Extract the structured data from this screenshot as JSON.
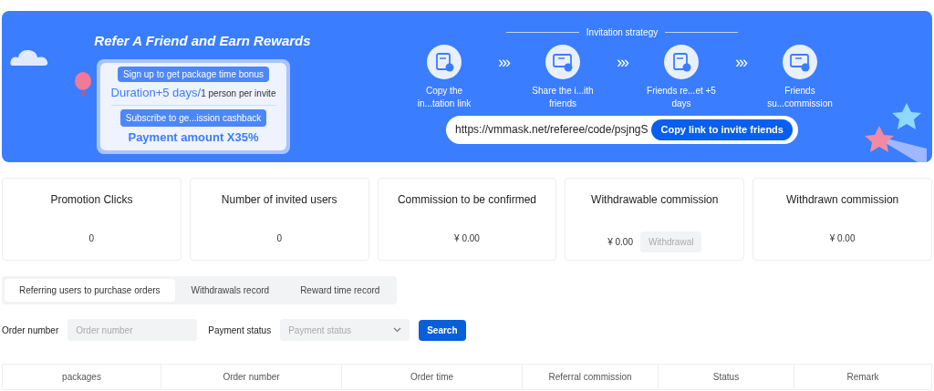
{
  "banner": {
    "title": "Refer A Friend and Earn Rewards",
    "signup_badge": "Sign up to get package time bonus",
    "duration": "Duration+5 days/",
    "per_invite": "1 person per invite",
    "subscribe_badge": "Subscribe to ge...ission cashback",
    "payment": "Payment amount X35%",
    "strategy_title": "Invitation strategy",
    "steps": [
      {
        "label": "Copy the in...tation link"
      },
      {
        "label": "Share the i...ith friends"
      },
      {
        "label": "Friends re...et +5 days"
      },
      {
        "label": "Friends su...commission"
      }
    ],
    "step_arrow": "›››",
    "link": "https://vmmask.net/referee/code/psjngS",
    "copy_button": "Copy link to invite friends"
  },
  "stats": [
    {
      "title": "Promotion Clicks",
      "value": "0"
    },
    {
      "title": "Number of invited users",
      "value": "0"
    },
    {
      "title": "Commission to be confirmed",
      "value": "¥ 0.00"
    },
    {
      "title": "Withdrawable commission",
      "value": "¥ 0.00",
      "action": "Withdrawal"
    },
    {
      "title": "Withdrawn commission",
      "value": "¥ 0.00"
    }
  ],
  "tabs": [
    {
      "label": "Referring users to purchase orders",
      "selected": true
    },
    {
      "label": "Withdrawals record",
      "selected": false
    },
    {
      "label": "Reward time record",
      "selected": false
    }
  ],
  "filters": {
    "order_label": "Order number",
    "order_placeholder": "Order number",
    "status_label": "Payment status",
    "status_placeholder": "Payment status",
    "search_button": "Search"
  },
  "table": {
    "columns": [
      "packages",
      "Order number",
      "Order time",
      "Referral commission",
      "Status",
      "Remark"
    ]
  }
}
